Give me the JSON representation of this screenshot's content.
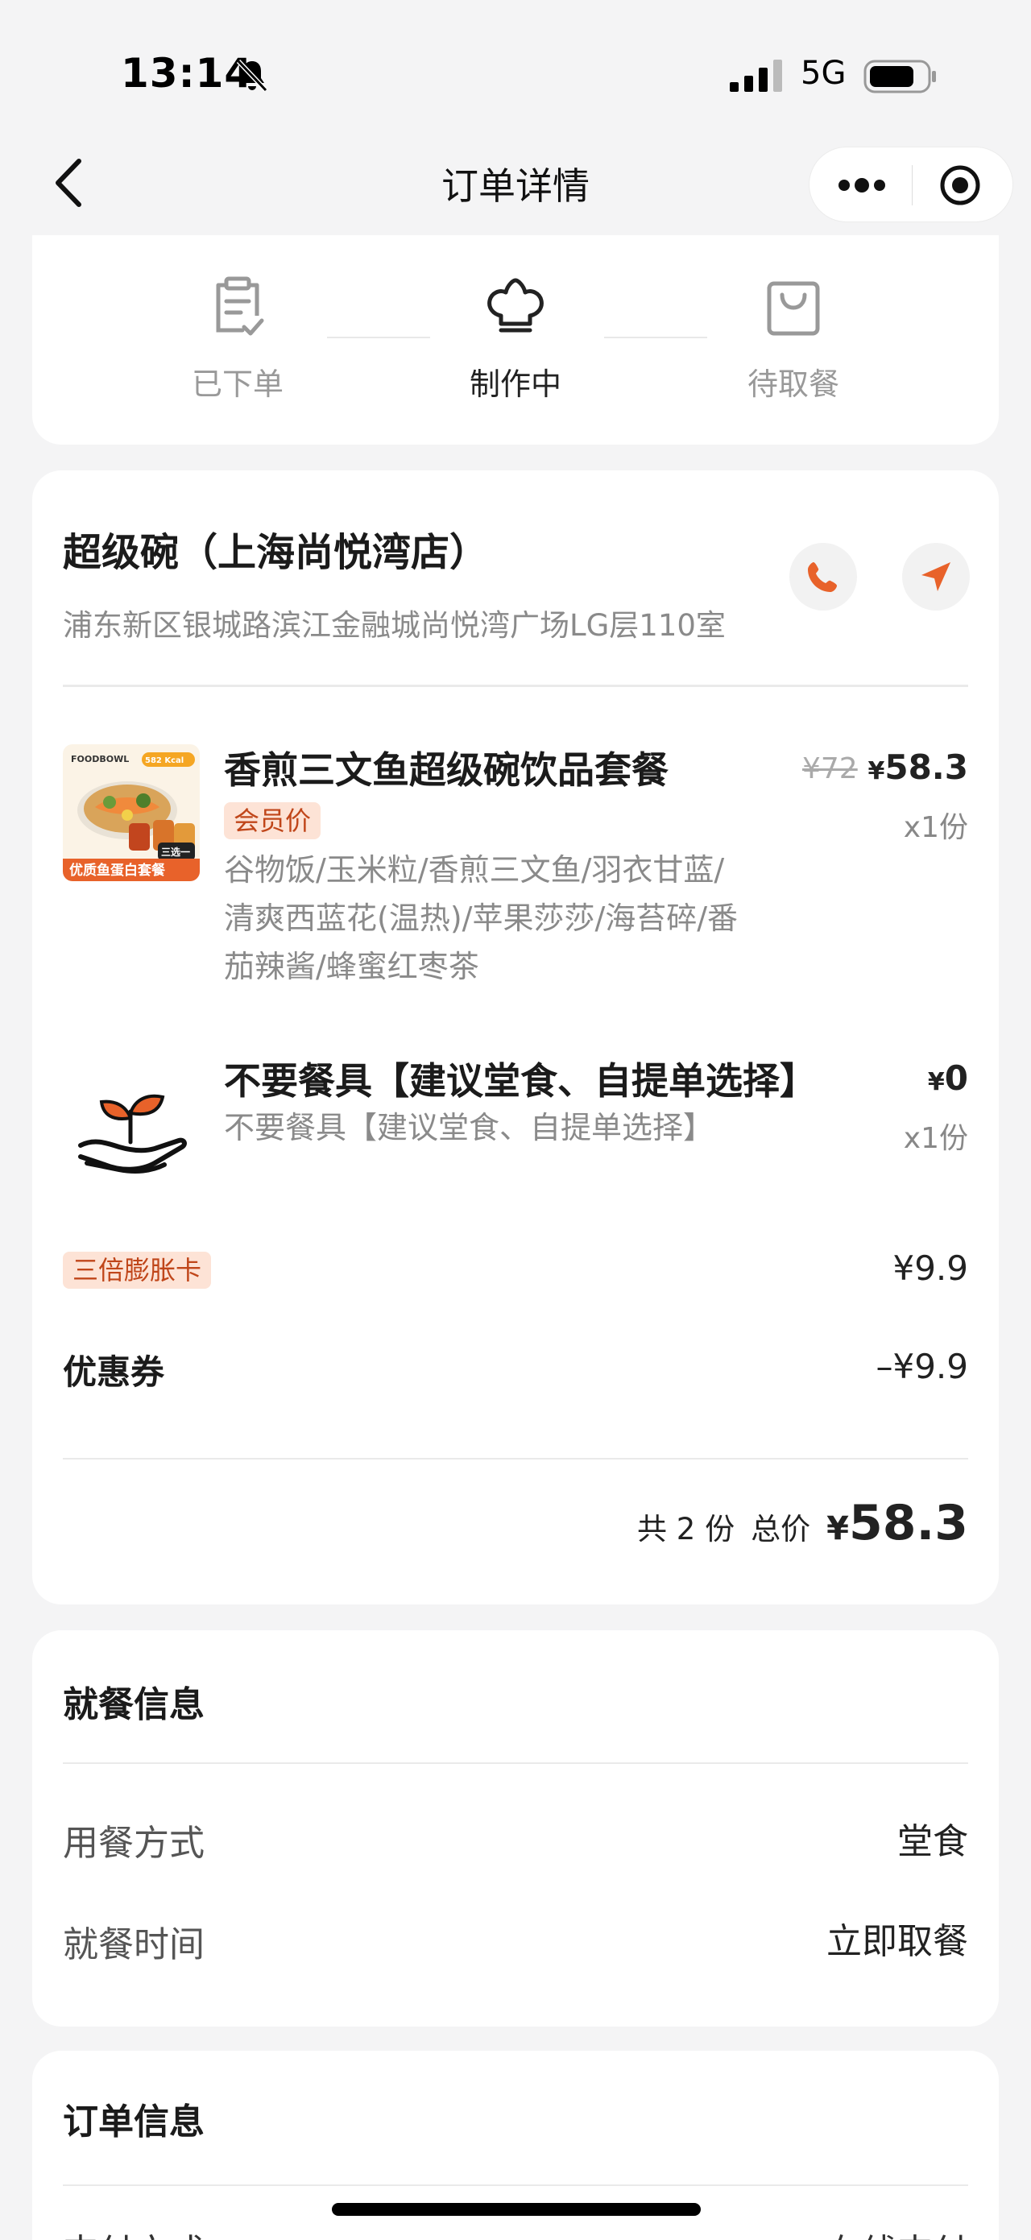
{
  "status_bar": {
    "time": "13:14",
    "network": "5G"
  },
  "nav": {
    "title": "订单详情"
  },
  "progress": {
    "steps": [
      {
        "label": "已下单",
        "icon": "order-placed-icon",
        "state": "done"
      },
      {
        "label": "制作中",
        "icon": "chef-hat-icon",
        "state": "active"
      },
      {
        "label": "待取餐",
        "icon": "bag-icon",
        "state": "pending"
      }
    ]
  },
  "store": {
    "name": "超级碗（上海尚悦湾店）",
    "address": "浦东新区银城路滨江金融城尚悦湾广场LG层110室"
  },
  "items": [
    {
      "name": "香煎三文鱼超级碗饮品套餐",
      "badge": "会员价",
      "desc_lines": [
        "谷物饭/玉米粒/香煎三文鱼/羽衣甘蓝/",
        "清爽西蓝花(温热)/苹果莎莎/海苔碎/番",
        "茄辣酱/蜂蜜红枣茶"
      ],
      "price_old": "¥72",
      "price_yen": "¥",
      "price": "58.3",
      "qty": "x1份",
      "img_brand": "FOODBOWL",
      "img_kcal": "582 Kcal",
      "img_tag": "三选一",
      "img_caption": "优质鱼蛋白套餐"
    },
    {
      "name": "不要餐具【建议堂食、自提单选择】",
      "desc": "不要餐具【建议堂食、自提单选择】",
      "price_yen": "¥",
      "price": "0",
      "qty": "x1份"
    }
  ],
  "card_line": {
    "label": "三倍膨胀卡",
    "value": "¥9.9"
  },
  "coupon": {
    "label": "优惠券",
    "value": "–¥9.9"
  },
  "total": {
    "count_label": "共 2 份",
    "total_label": "总价",
    "yen": "¥",
    "amount": "58.3"
  },
  "dine_info": {
    "title": "就餐信息",
    "rows": [
      {
        "label": "用餐方式",
        "value": "堂食"
      },
      {
        "label": "就餐时间",
        "value": "立即取餐"
      }
    ]
  },
  "order_info": {
    "title": "订单信息",
    "peek_left": "支付方式",
    "peek_right": "在线支付"
  },
  "colors": {
    "accent": "#e8622a",
    "badge_bg": "#fde3d6",
    "badge_text": "#c0461a"
  }
}
